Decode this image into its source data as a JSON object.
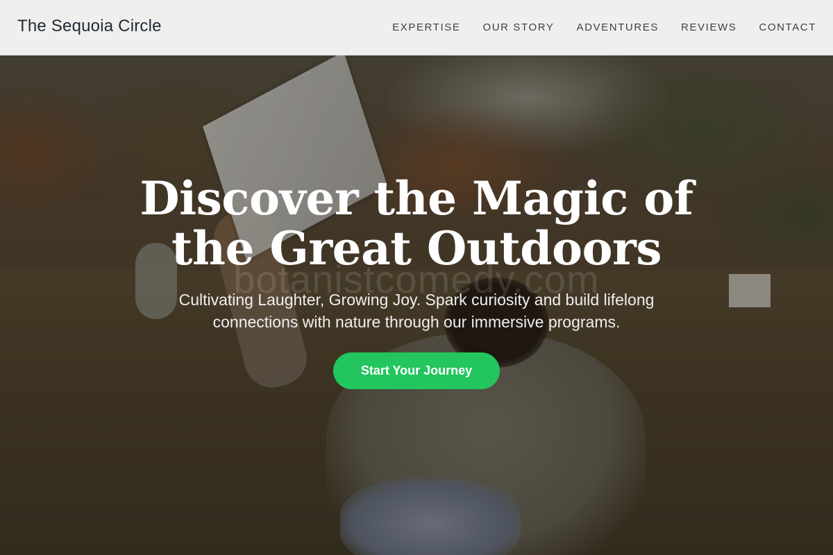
{
  "nav": {
    "brand": "The Sequoia Circle",
    "links": [
      {
        "label": "EXPERTISE"
      },
      {
        "label": "OUR STORY"
      },
      {
        "label": "ADVENTURES"
      },
      {
        "label": "REVIEWS"
      },
      {
        "label": "CONTACT"
      }
    ]
  },
  "hero": {
    "title": "Discover the Magic of the Great Outdoors",
    "watermark": "botanistcomedy.com",
    "subtitle": "Cultivating Laughter, Growing Joy. Spark curiosity and build lifelong connections with nature through our immersive programs.",
    "cta_label": "Start Your Journey"
  },
  "colors": {
    "accent": "#22c55e",
    "nav_background": "#f5f5f5",
    "brand_text": "#1f2833"
  }
}
